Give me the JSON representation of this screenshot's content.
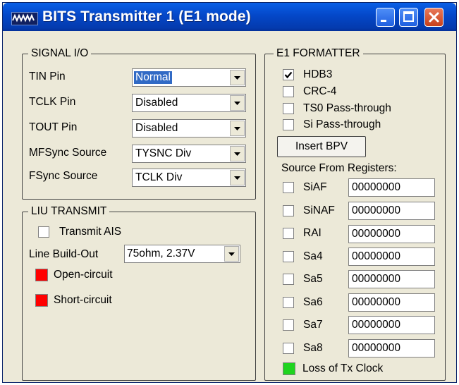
{
  "window": {
    "title": "BITS Transmitter 1 (E1 mode)"
  },
  "signal_io": {
    "legend": "SIGNAL I/O",
    "rows": [
      {
        "label": "TIN Pin",
        "value": "Normal"
      },
      {
        "label": "TCLK Pin",
        "value": "Disabled"
      },
      {
        "label": "TOUT Pin",
        "value": "Disabled"
      },
      {
        "label": "MFSync Source",
        "value": "TYSNC Div"
      },
      {
        "label": "FSync Source",
        "value": "TCLK Div"
      }
    ]
  },
  "liu_transmit": {
    "legend": "LIU TRANSMIT",
    "transmit_ais": {
      "label": "Transmit AIS",
      "checked": false
    },
    "line_build_out": {
      "label": "Line Build-Out",
      "value": "75ohm, 2.37V"
    },
    "open_circuit": {
      "label": "Open-circuit",
      "color": "#ff0000"
    },
    "short_circuit": {
      "label": "Short-circuit",
      "color": "#ff0000"
    }
  },
  "e1_formatter": {
    "legend": "E1 FORMATTER",
    "options": [
      {
        "label": "HDB3",
        "checked": true
      },
      {
        "label": "CRC-4",
        "checked": false
      },
      {
        "label": "TS0 Pass-through",
        "checked": false
      },
      {
        "label": "Si Pass-through",
        "checked": false
      }
    ],
    "insert_bpv_label": "Insert BPV",
    "source_label": "Source From Registers:",
    "registers": [
      {
        "label": "SiAF",
        "value": "00000000",
        "checked": false
      },
      {
        "label": "SiNAF",
        "value": "00000000",
        "checked": false
      },
      {
        "label": "RAI",
        "value": "00000000",
        "checked": false
      },
      {
        "label": "Sa4",
        "value": "00000000",
        "checked": false
      },
      {
        "label": "Sa5",
        "value": "00000000",
        "checked": false
      },
      {
        "label": "Sa6",
        "value": "00000000",
        "checked": false
      },
      {
        "label": "Sa7",
        "value": "00000000",
        "checked": false
      },
      {
        "label": "Sa8",
        "value": "00000000",
        "checked": false
      }
    ],
    "loss_of_tx_clock": {
      "label": "Loss of Tx Clock",
      "color": "#1fd41f"
    }
  }
}
